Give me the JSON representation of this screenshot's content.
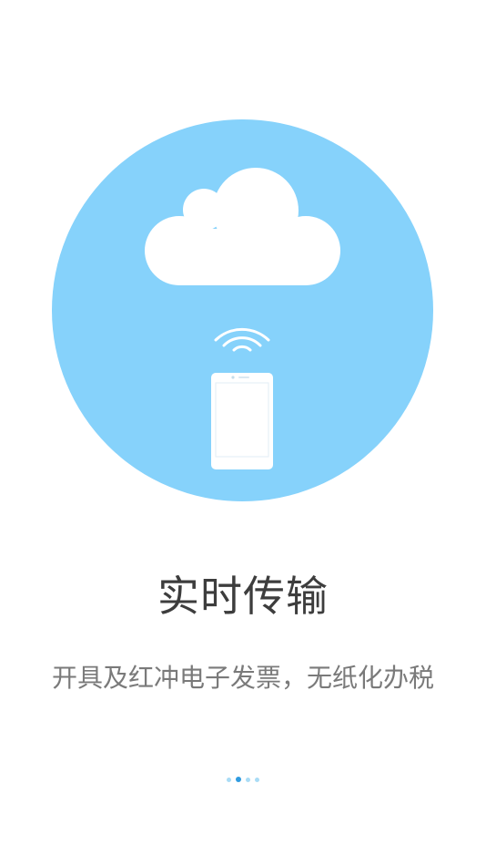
{
  "onboarding": {
    "title": "实时传输",
    "subtitle": "开具及红冲电子发票，无纸化办税",
    "pager": {
      "total": 4,
      "active_index": 1
    }
  },
  "colors": {
    "circle": "#86d2fb",
    "foreground": "#ffffff",
    "title_text": "#3d3d3d",
    "subtitle_text": "#7a7a7a",
    "dot_active": "#2f9be0",
    "dot_inactive": "#a9dcf6"
  },
  "icons": [
    "cloud-icon",
    "wifi-signal-icon",
    "smartphone-icon"
  ]
}
